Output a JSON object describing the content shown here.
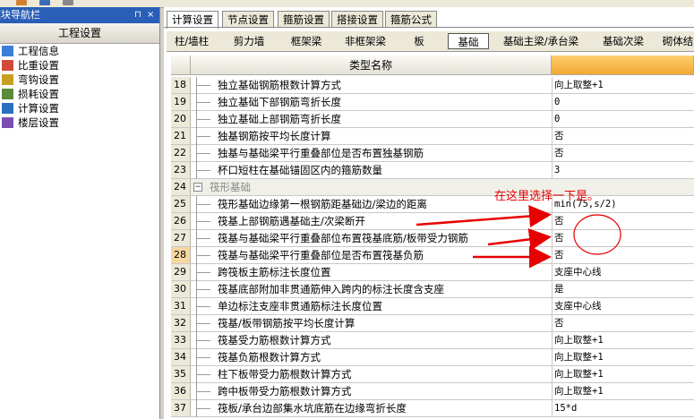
{
  "colors": {
    "arrow": "#e60000",
    "title_bar": "#2b5fb7",
    "selected_row_num": "#f6d7a0"
  },
  "left_panel": {
    "title": "模块导航栏",
    "pin_glyph": "⊓",
    "close_glyph": "×",
    "header": "工程设置",
    "items": [
      {
        "label": "工程信息",
        "icon": "info-icon"
      },
      {
        "label": "比重设置",
        "icon": "ratio-icon"
      },
      {
        "label": "弯钩设置",
        "icon": "hook-icon"
      },
      {
        "label": "损耗设置",
        "icon": "loss-icon"
      },
      {
        "label": "计算设置",
        "icon": "calc-icon"
      },
      {
        "label": "楼层设置",
        "icon": "floor-icon"
      }
    ]
  },
  "tabs": [
    "计算设置",
    "节点设置",
    "箍筋设置",
    "搭接设置",
    "箍筋公式"
  ],
  "subtabs": [
    "柱/墙柱",
    "剪力墙",
    "框架梁",
    "非框架梁",
    "板",
    "基础",
    "基础主梁/承台梁",
    "基础次梁",
    "砌体结"
  ],
  "table": {
    "header_name": "类型名称",
    "rows": [
      {
        "num": "18",
        "name": "独立基础钢筋根数计算方式",
        "value": "向上取整+1"
      },
      {
        "num": "19",
        "name": "独立基础下部钢筋弯折长度",
        "value": "0"
      },
      {
        "num": "20",
        "name": "独立基础上部钢筋弯折长度",
        "value": "0"
      },
      {
        "num": "21",
        "name": "独基钢筋按平均长度计算",
        "value": "否"
      },
      {
        "num": "22",
        "name": "独基与基础梁平行重叠部位是否布置独基钢筋",
        "value": "否"
      },
      {
        "num": "23",
        "name": "杯口短柱在基础锚固区内的箍筋数量",
        "value": "3"
      },
      {
        "num": "24",
        "name": "筏形基础",
        "value": "",
        "group": true
      },
      {
        "num": "25",
        "name": "筏形基础边缘第一根钢筋距基础边/梁边的距离",
        "value": "min(75,s/2)"
      },
      {
        "num": "26",
        "name": "筏基上部钢筋遇基础主/次梁断开",
        "value": "否"
      },
      {
        "num": "27",
        "name": "筏基与基础梁平行重叠部位布置筏基底筋/板带受力钢筋",
        "value": "否"
      },
      {
        "num": "28",
        "name": "筏基与基础梁平行重叠部位是否布置筏基负筋",
        "value": "否",
        "selected": true
      },
      {
        "num": "29",
        "name": "跨筏板主筋标注长度位置",
        "value": "支座中心线"
      },
      {
        "num": "30",
        "name": "筏基底部附加非贯通筋伸入跨内的标注长度含支座",
        "value": "是"
      },
      {
        "num": "31",
        "name": "单边标注支座非贯通筋标注长度位置",
        "value": "支座中心线"
      },
      {
        "num": "32",
        "name": "筏基/板带钢筋按平均长度计算",
        "value": "否"
      },
      {
        "num": "33",
        "name": "筏基受力筋根数计算方式",
        "value": "向上取整+1"
      },
      {
        "num": "34",
        "name": "筏基负筋根数计算方式",
        "value": "向上取整+1"
      },
      {
        "num": "35",
        "name": "柱下板带受力筋根数计算方式",
        "value": "向上取整+1"
      },
      {
        "num": "36",
        "name": "跨中板带受力筋根数计算方式",
        "value": "向上取整+1"
      },
      {
        "num": "37",
        "name": "筏板/承台边部集水坑底筋在边缘弯折长度",
        "value": "15*d"
      }
    ]
  },
  "annotation": {
    "text": "在这里选择一下是。"
  }
}
